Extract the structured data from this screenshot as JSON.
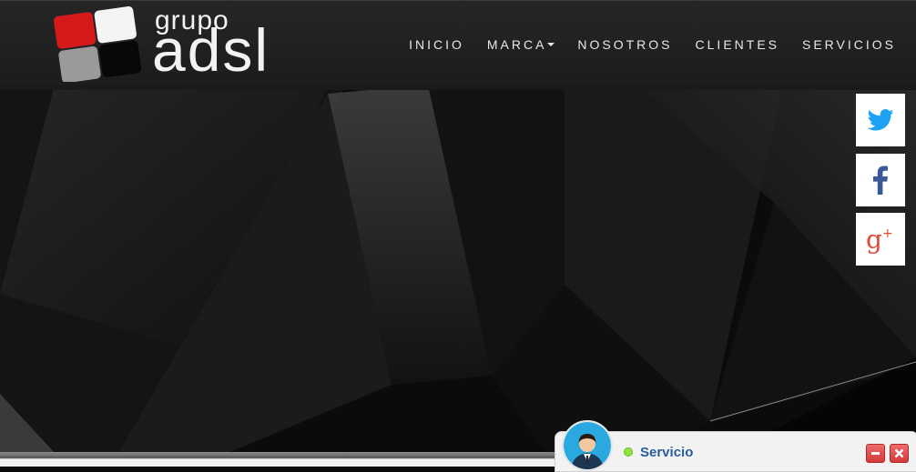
{
  "logo": {
    "small_text": "grupo",
    "big_text": "adsl"
  },
  "nav": {
    "items": [
      {
        "label": "INICIO"
      },
      {
        "label": "MARCA"
      },
      {
        "label": "NOSOTROS"
      },
      {
        "label": "CLIENTES"
      },
      {
        "label": "SERVICIOS"
      }
    ]
  },
  "social": [
    {
      "icon": "twitter-icon",
      "color": "#1da1f2"
    },
    {
      "icon": "facebook-icon",
      "color": "#3b5998"
    },
    {
      "icon": "google-plus-icon",
      "color": "#dd4b39"
    }
  ],
  "chat": {
    "title": "Servicio",
    "status_color": "#8fe63a"
  }
}
